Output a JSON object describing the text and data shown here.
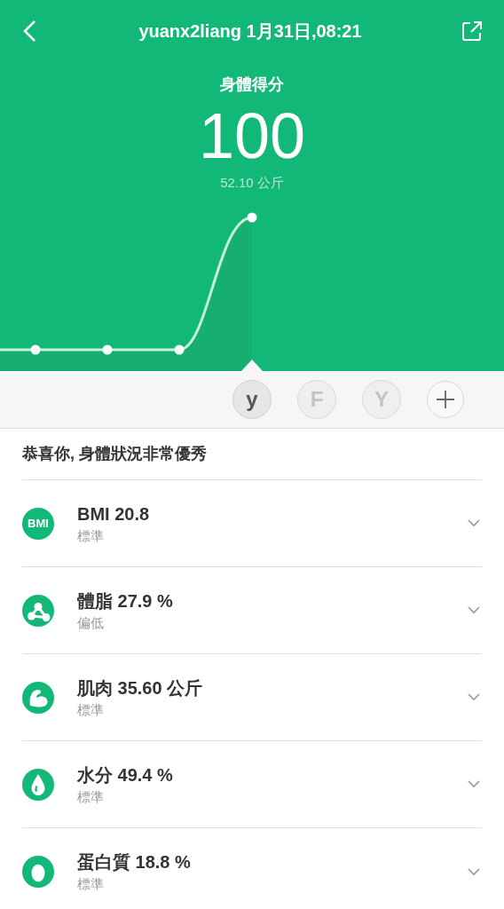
{
  "header": {
    "title": "yuanx2liang 1月31日,08:21"
  },
  "score": {
    "label": "身體得分",
    "value": "100",
    "weight": "52.10 公斤"
  },
  "users": [
    {
      "initial": "y",
      "selected": true
    },
    {
      "initial": "F",
      "selected": false
    },
    {
      "initial": "Y",
      "selected": false
    }
  ],
  "summary": "恭喜你, 身體狀況非常優秀",
  "metrics": [
    {
      "kind": "bmi",
      "icon_label": "BMI",
      "title": "BMI 20.8",
      "status": "標準"
    },
    {
      "kind": "fat",
      "title": "體脂 27.9 %",
      "status": "偏低"
    },
    {
      "kind": "muscle",
      "title": "肌肉 35.60 公斤",
      "status": "標準"
    },
    {
      "kind": "water",
      "title": "水分 49.4 %",
      "status": "標準"
    },
    {
      "kind": "protein",
      "title": "蛋白質 18.8 %",
      "status": "標準"
    }
  ]
}
